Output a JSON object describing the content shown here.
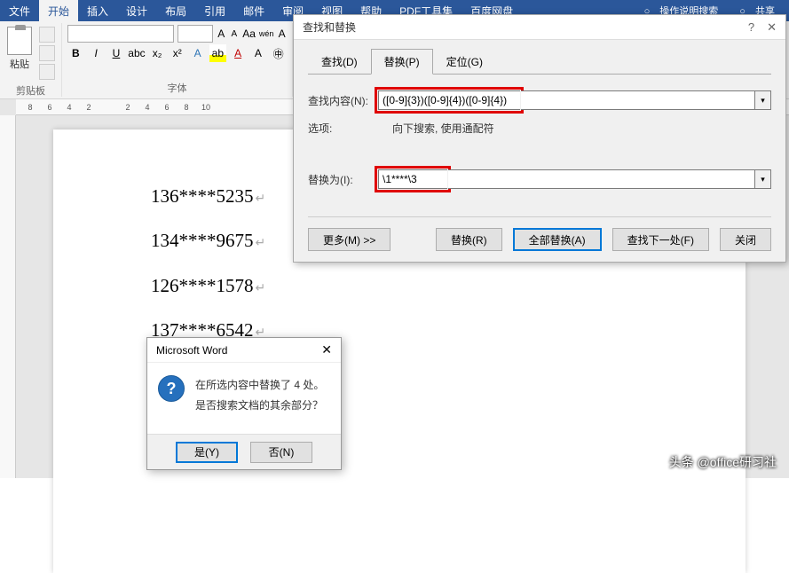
{
  "menu": {
    "items": [
      "文件",
      "开始",
      "插入",
      "设计",
      "布局",
      "引用",
      "邮件",
      "审阅",
      "视图",
      "帮助",
      "PDF工具集",
      "百度网盘"
    ],
    "active": "开始",
    "search_prefix": "操作说明搜索",
    "share": "共享"
  },
  "ribbon": {
    "clipboard_label": "剪贴板",
    "paste_label": "粘贴",
    "font_label": "字体",
    "font_name": "",
    "font_size": "",
    "wen": "wén"
  },
  "ruler": [
    "8",
    "6",
    "4",
    "2",
    "",
    "2",
    "4",
    "6",
    "8",
    "10"
  ],
  "document": {
    "lines": [
      "136****5235",
      "134****9675",
      "126****1578",
      "137****6542"
    ]
  },
  "dialog": {
    "title": "查找和替换",
    "tabs": {
      "find": "查找(D)",
      "replace": "替换(P)",
      "goto": "定位(G)"
    },
    "find_label": "查找内容(N):",
    "find_value": "([0-9]{3})([0-9]{4})([0-9]{4})",
    "options_label": "选项:",
    "options_value": "向下搜索, 使用通配符",
    "replace_label": "替换为(I):",
    "replace_value": "\\1****\\3",
    "buttons": {
      "more": "更多(M) >>",
      "replace": "替换(R)",
      "replace_all": "全部替换(A)",
      "find_next": "查找下一处(F)",
      "close": "关闭"
    }
  },
  "msgbox": {
    "title": "Microsoft Word",
    "line1": "在所选内容中替换了 4 处。",
    "line2": "是否搜索文档的其余部分？",
    "yes": "是(Y)",
    "no": "否(N)"
  },
  "watermark": "头条 @office研习社"
}
